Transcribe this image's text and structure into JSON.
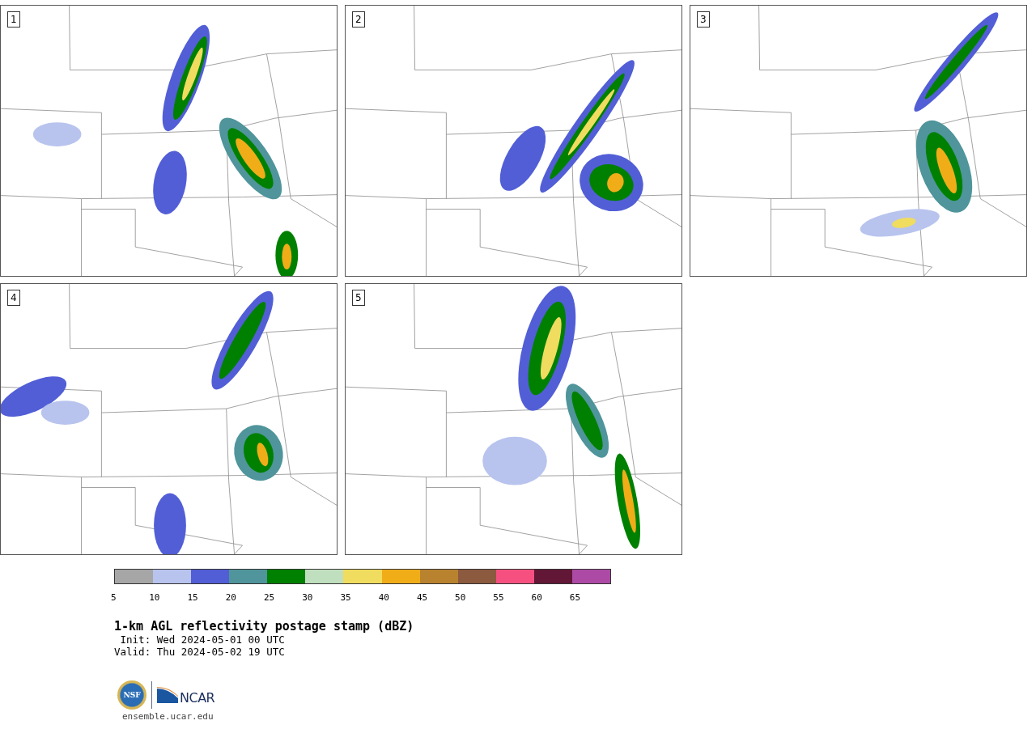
{
  "panels": [
    {
      "label": "1"
    },
    {
      "label": "2"
    },
    {
      "label": "3"
    },
    {
      "label": "4"
    },
    {
      "label": "5"
    }
  ],
  "colorbar": {
    "segments": [
      {
        "color": "#a6a6a6"
      },
      {
        "color": "#b8c4ee"
      },
      {
        "color": "#525ed6"
      },
      {
        "color": "#4f959b"
      },
      {
        "color": "#008000"
      },
      {
        "color": "#c0dfbe"
      },
      {
        "color": "#f0dc5e"
      },
      {
        "color": "#f0ad18"
      },
      {
        "color": "#b9822f"
      },
      {
        "color": "#8b5a3f"
      },
      {
        "color": "#f55080"
      },
      {
        "color": "#621737"
      },
      {
        "color": "#ad4aa6"
      }
    ],
    "ticks": [
      "5",
      "10",
      "15",
      "20",
      "25",
      "30",
      "35",
      "40",
      "45",
      "50",
      "55",
      "60",
      "65"
    ]
  },
  "title": "1-km AGL reflectivity postage stamp (dBZ)",
  "init": " Init: Wed 2024-05-01 00 UTC",
  "valid": "Valid: Thu 2024-05-02 19 UTC",
  "logos": {
    "nsf": "NSF",
    "ncar": "NCAR"
  },
  "site": "ensemble.ucar.edu"
}
